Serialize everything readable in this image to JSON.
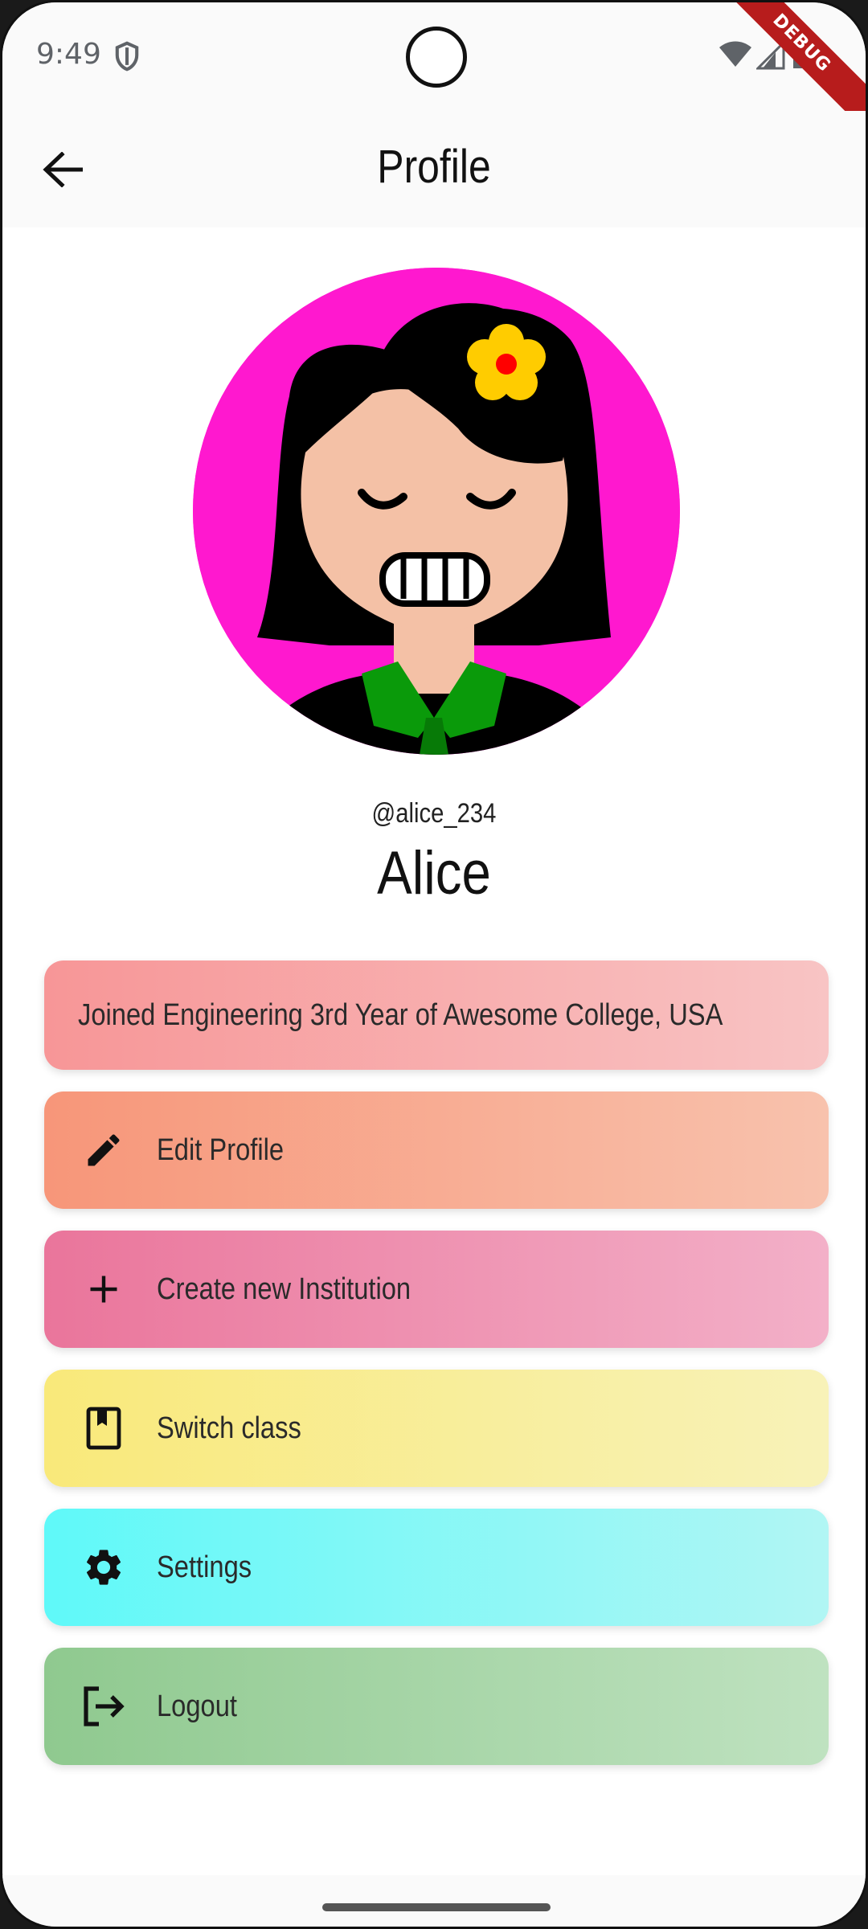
{
  "status_bar": {
    "time": "9:49"
  },
  "debug_banner": "DEBUG",
  "app_bar": {
    "title": "Profile"
  },
  "profile": {
    "username": "@alice_234",
    "name": "Alice"
  },
  "info": "Joined Engineering 3rd Year of Awesome College, USA",
  "actions": [
    {
      "label": "Edit Profile",
      "icon": "pencil-icon"
    },
    {
      "label": "Create new Institution",
      "icon": "plus-icon"
    },
    {
      "label": "Switch class",
      "icon": "book-icon"
    },
    {
      "label": "Settings",
      "icon": "gear-icon"
    },
    {
      "label": "Logout",
      "icon": "logout-icon"
    }
  ],
  "colors": {
    "avatar_bg": "#ff18cf",
    "info": "#f79697",
    "edit": "#f79679",
    "create": "#ea759b",
    "switch": "#f9e97a",
    "settings": "#5ff9f9",
    "logout": "#8fc98f"
  }
}
